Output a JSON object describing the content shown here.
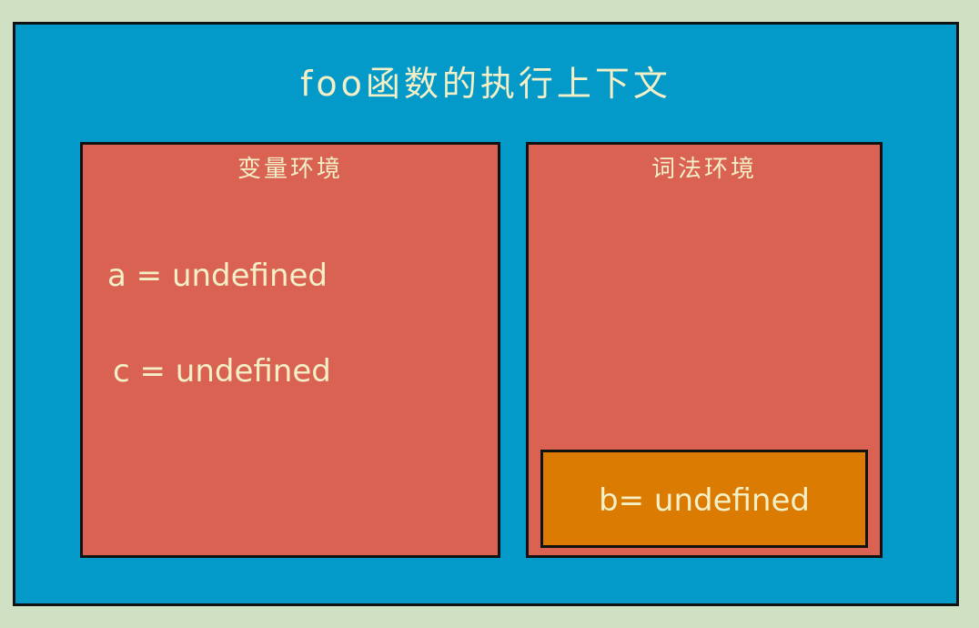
{
  "diagram": {
    "title": "foo函数的执行上下文",
    "variable_environment": {
      "label": "变量环境",
      "entries": [
        "a = undefined",
        "c = undefined"
      ]
    },
    "lexical_environment": {
      "label": "词法环境",
      "inner_block": {
        "entry": "b= undefined"
      }
    }
  },
  "colors": {
    "page_background": "#cfe0c3",
    "outer_box": "#0399c8",
    "environment_box": "#da6253",
    "inner_block": "#dc7b02",
    "text": "#f3efc6",
    "border": "#111111"
  }
}
